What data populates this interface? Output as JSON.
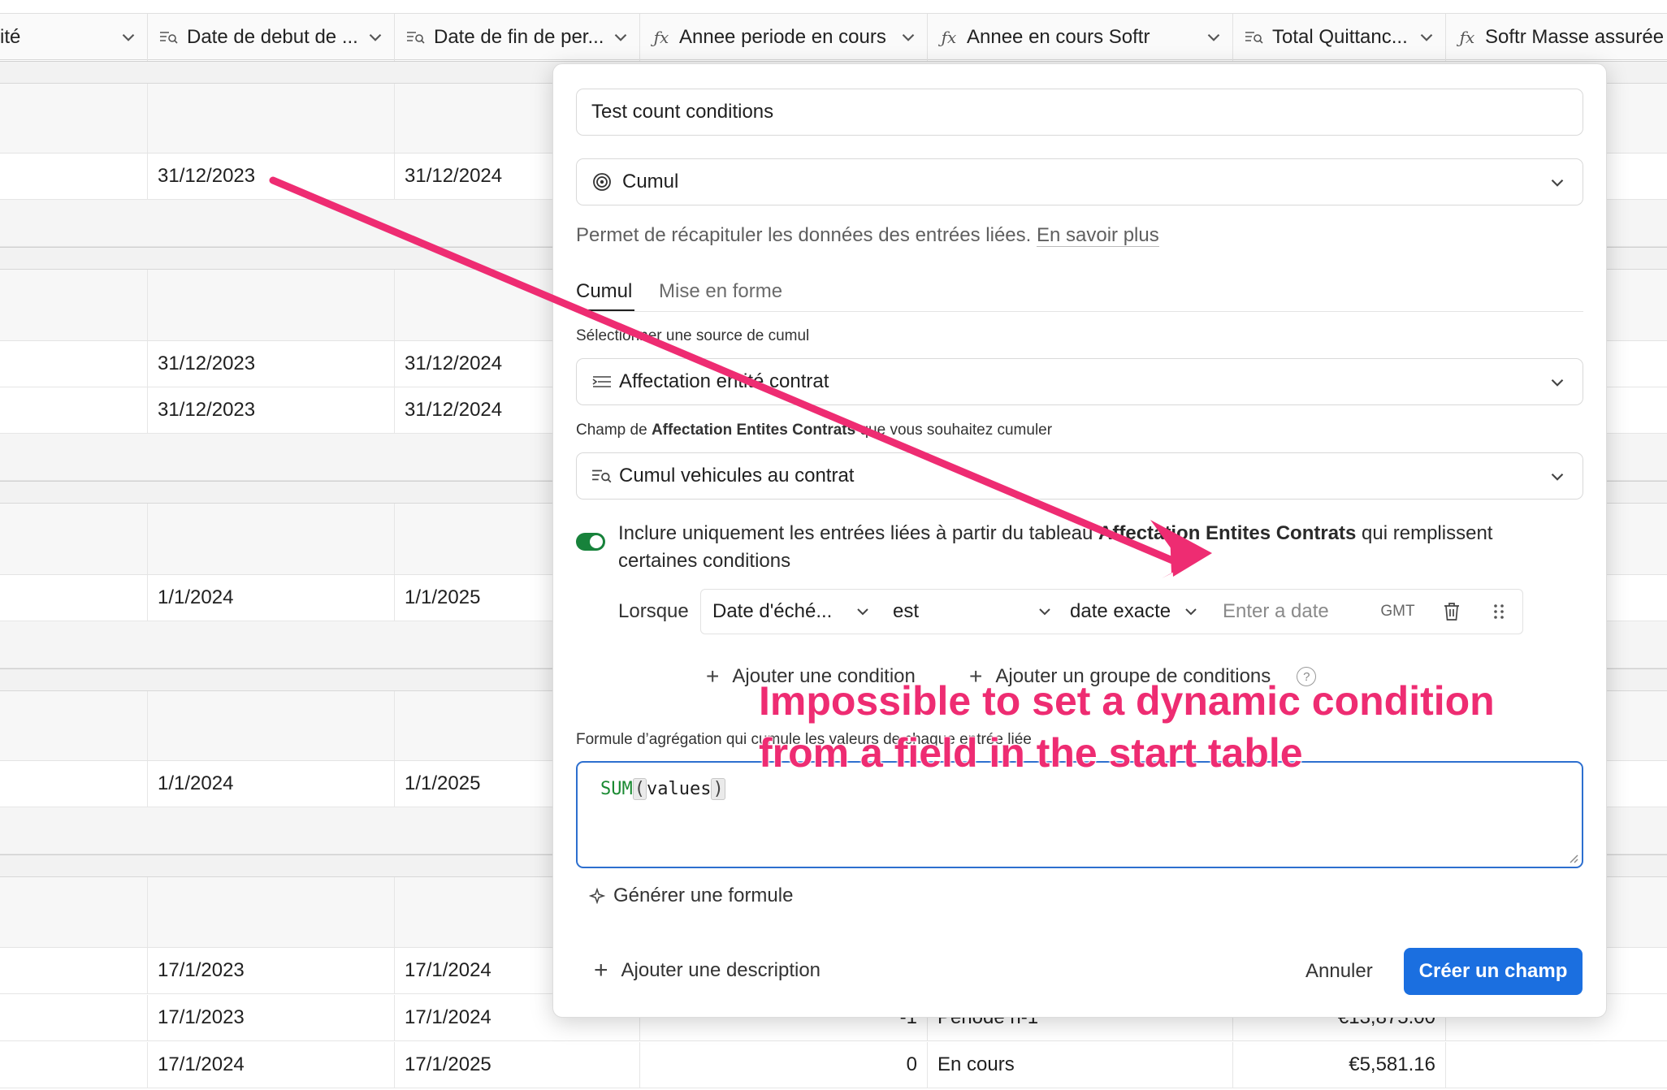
{
  "grid": {
    "columns": [
      {
        "label": "ité",
        "icon": "none"
      },
      {
        "label": "Date de debut de ...",
        "icon": "lookup-icon"
      },
      {
        "label": "Date de fin de per...",
        "icon": "lookup-icon"
      },
      {
        "label": "Annee periode en cours",
        "icon": "formula-icon"
      },
      {
        "label": "Annee en cours Softr",
        "icon": "formula-icon"
      },
      {
        "label": "Total Quittanc...",
        "icon": "lookup-icon"
      },
      {
        "label": "Softr Masse assurée",
        "icon": "formula-icon"
      }
    ],
    "rows": [
      {
        "debut": "31/12/2023",
        "fin": "31/12/2024"
      },
      {
        "debut": "31/12/2023",
        "fin": "31/12/2024"
      },
      {
        "debut": "31/12/2023",
        "fin": "31/12/2024"
      },
      {
        "debut": "1/1/2024",
        "fin": "1/1/2025"
      },
      {
        "debut": "1/1/2024",
        "fin": "1/1/2025"
      },
      {
        "debut": "17/1/2023",
        "fin": "17/1/2024"
      },
      {
        "debut": "17/1/2023",
        "fin": "17/1/2024",
        "annee": "-1",
        "softr": "Periode n-1",
        "total": "€13,875.00"
      },
      {
        "debut": "17/1/2024",
        "fin": "17/1/2025",
        "annee": "0",
        "softr": "En cours",
        "total": "€5,581.16"
      }
    ]
  },
  "dialog": {
    "field_name": "Test count conditions",
    "field_type": "Cumul",
    "type_icon": "rollup-icon",
    "description_text": "Permet de récapituler les données des entrées liées.",
    "learn_more": "En savoir plus",
    "tabs": [
      "Cumul",
      "Mise en forme"
    ],
    "source_label": "Sélectionner une source de cumul",
    "source_value": "Affectation entité contrat",
    "field_label_prefix": "Champ de ",
    "field_label_bold": "Affectation Entites Contrats",
    "field_label_suffix": " que vous souhaitez cumuler",
    "field_value": "Cumul vehicules au contrat",
    "filter_toggle_label_a": "Inclure uniquement les entrées liées à partir du tableau ",
    "filter_toggle_label_bold": "Affectation Entites Contrats",
    "filter_toggle_label_b": " qui remplissent",
    "filter_toggle_label_c": "certaines conditions",
    "condition": {
      "when": "Lorsque",
      "field": "Date d'éché...",
      "operator": "est",
      "mode": "date exacte",
      "value_placeholder": "Enter a date",
      "timezone": "GMT"
    },
    "add_condition": "Ajouter une condition",
    "add_group": "Ajouter un groupe de conditions",
    "formula_label": "Formule d’agrégation qui cumule les valeurs de chaque entrée liée",
    "formula": {
      "fn": "SUM",
      "arg": "values"
    },
    "generate_formula": "Générer une formule",
    "add_description": "Ajouter une description",
    "cancel": "Annuler",
    "create": "Créer un champ"
  },
  "annotation": {
    "line1": "Impossible to set a dynamic condition",
    "line2": "from a field in the start table",
    "color": "#ee2c72"
  }
}
